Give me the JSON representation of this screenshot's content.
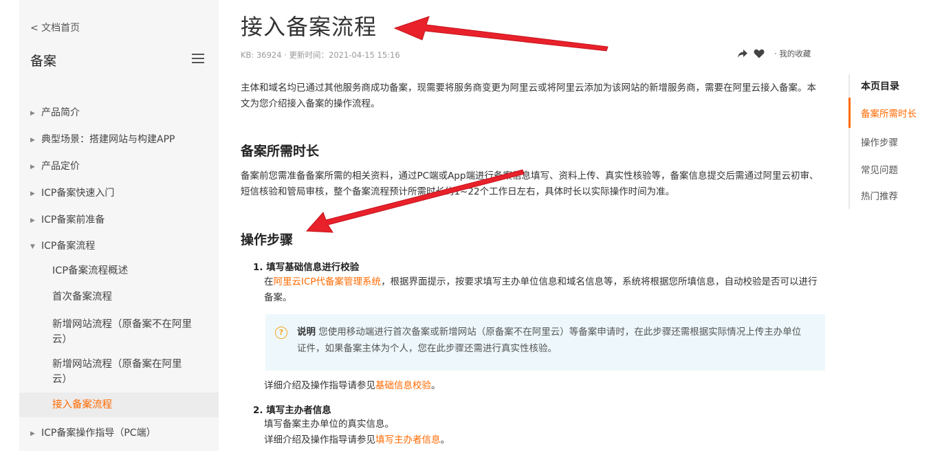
{
  "sidebar": {
    "back": "< 文档首页",
    "title": "备案",
    "items": [
      {
        "label": "产品简介",
        "caret": "▶"
      },
      {
        "label": "典型场景：搭建网站与构建APP",
        "caret": "▶"
      },
      {
        "label": "产品定价",
        "caret": "▶"
      },
      {
        "label": "ICP备案快速入门",
        "caret": "▶"
      },
      {
        "label": "ICP备案前准备",
        "caret": "▶"
      },
      {
        "label": "ICP备案流程",
        "caret": "▼"
      }
    ],
    "sub_items": [
      "ICP备案流程概述",
      "首次备案流程",
      "新增网站流程（原备案不在阿里云）",
      "新增网站流程（原备案在阿里云）",
      "接入备案流程"
    ],
    "last_item": {
      "label": "ICP备案操作指导（PC端）",
      "caret": "▶"
    }
  },
  "article": {
    "title": "接入备案流程",
    "meta": "KB: 36924 · 更新时间：2021-04-15 15:16",
    "favorites": "· 我的收藏",
    "intro": "主体和域名均已通过其他服务商成功备案，现需要将服务商变更为阿里云或将阿里云添加为该网站的新增服务商，需要在阿里云接入备案。本文为您介绍接入备案的操作流程。",
    "section1_title": "备案所需时长",
    "section1_text": "备案前您需准备备案所需的相关资料，通过PC端或App端进行备案信息填写、资料上传、真实性核验等，备案信息提交后需通过阿里云初审、短信核验和管局审核，整个备案流程预计所需时长约1~22个工作日左右，具体时长以实际操作时间为准。",
    "section2_title": "操作步骤",
    "step1_title": "1. 填写基础信息进行校验",
    "step1_pre": "在",
    "step1_link": "阿里云ICP代备案管理系统",
    "step1_post": "，根据界面提示，按要求填写主办单位信息和域名信息等，系统将根据您所填信息，自动校验是否可以进行备案。",
    "note_label": "说明",
    "note_text": " 您使用移动端进行首次备案或新增网站（原备案不在阿里云）等备案申请时，在此步骤还需根据实际情况上传主办单位证件，如果备案主体为个人，您在此步骤还需进行真实性核验。",
    "step1_detail_pre": "详细介绍及操作指导请参见",
    "step1_detail_link": "基础信息校验",
    "step1_detail_post": "。",
    "step2_title": "2. 填写主办者信息",
    "step2_text": "填写备案主办单位的真实信息。",
    "step2_detail_pre": "详细介绍及操作指导请参见",
    "step2_detail_link": "填写主办者信息",
    "step2_detail_post": "。"
  },
  "toc": {
    "title": "本页目录",
    "items": [
      "备案所需时长",
      "操作步骤",
      "常见问题",
      "热门推荐"
    ]
  },
  "colors": {
    "accent": "#ff6a00",
    "arrow": "#e8212b",
    "note_bg": "#eef8fc"
  }
}
